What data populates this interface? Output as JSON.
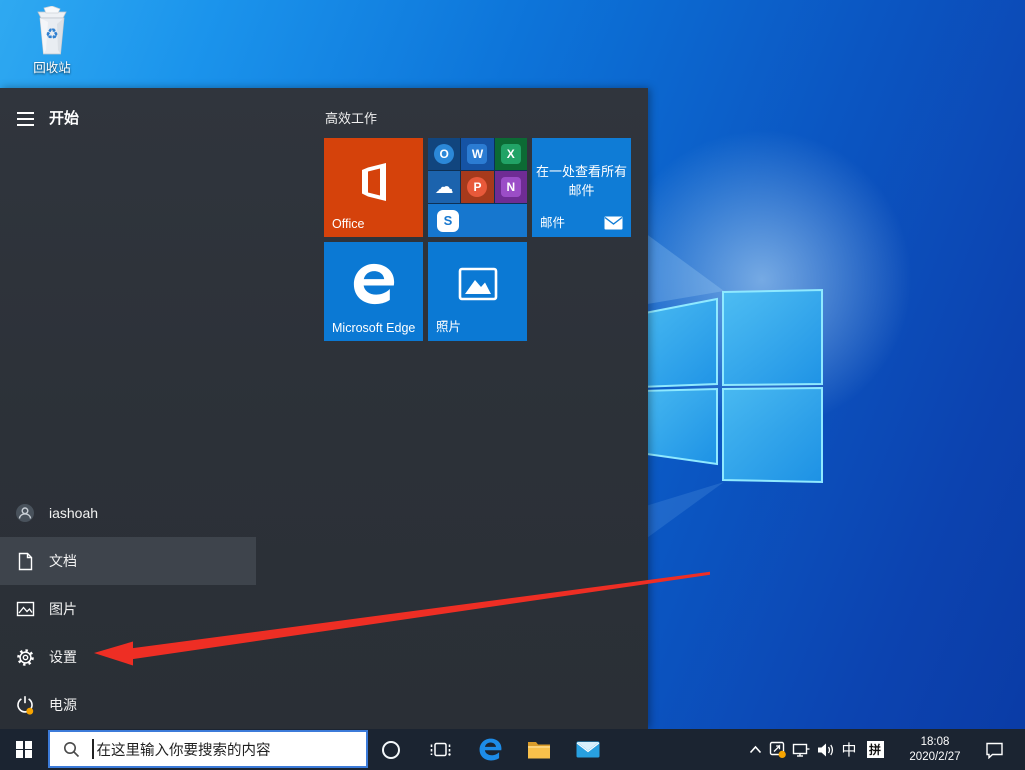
{
  "desktop": {
    "recycle_bin_label": "回收站"
  },
  "start_menu": {
    "header": {
      "title": "开始"
    },
    "tile_group_title": "高效工作",
    "tiles": {
      "office": {
        "label": "Office",
        "color": "#d5420b"
      },
      "suite": {
        "apps": [
          {
            "name": "outlook",
            "letter": "O",
            "cell_color": "#11457e",
            "icon_color": "#2b88d8"
          },
          {
            "name": "word",
            "letter": "W",
            "cell_color": "#1553a4",
            "icon_color": "#2b7cd3"
          },
          {
            "name": "excel",
            "letter": "X",
            "cell_color": "#0c6a34",
            "icon_color": "#21a366"
          },
          {
            "name": "onedrive",
            "letter": "☁",
            "cell_color": "#1c63ad",
            "icon_color": "#ffffff"
          },
          {
            "name": "powerpoint",
            "letter": "P",
            "cell_color": "#a63a1c",
            "icon_color": "#e8593a"
          },
          {
            "name": "onenote",
            "letter": "N",
            "cell_color": "#6f2c94",
            "icon_color": "#9b4dc7"
          },
          {
            "name": "skype",
            "letter": "S",
            "cell_color": "#1677cf",
            "icon_color": "#ffffff"
          }
        ]
      },
      "mail": {
        "line1": "在一处查看所有",
        "line2": "邮件",
        "label": "邮件",
        "color": "#0f7cd6"
      },
      "edge": {
        "label": "Microsoft Edge",
        "color": "#0b79d4"
      },
      "photos": {
        "label": "照片",
        "color": "#0b79d4"
      }
    },
    "items": [
      {
        "id": "user",
        "label": "iashoah"
      },
      {
        "id": "documents",
        "label": "文档"
      },
      {
        "id": "pictures",
        "label": "图片"
      },
      {
        "id": "settings",
        "label": "设置"
      },
      {
        "id": "power",
        "label": "电源"
      }
    ]
  },
  "annotation_arrow": {
    "color": "#ee2e24",
    "points_to": "设置"
  },
  "taskbar": {
    "search": {
      "placeholder": "在这里输入你要搜索的内容"
    },
    "tray": {
      "ime_language": "中",
      "ime_mode": "拼",
      "clock": {
        "time": "18:08",
        "date": "2020/2/27"
      }
    }
  },
  "icons": {
    "recycle-symbol": "♻",
    "onedrive-cloud": "☁",
    "hamburger-icon": "≡",
    "tray-expand-chevron": "^"
  }
}
